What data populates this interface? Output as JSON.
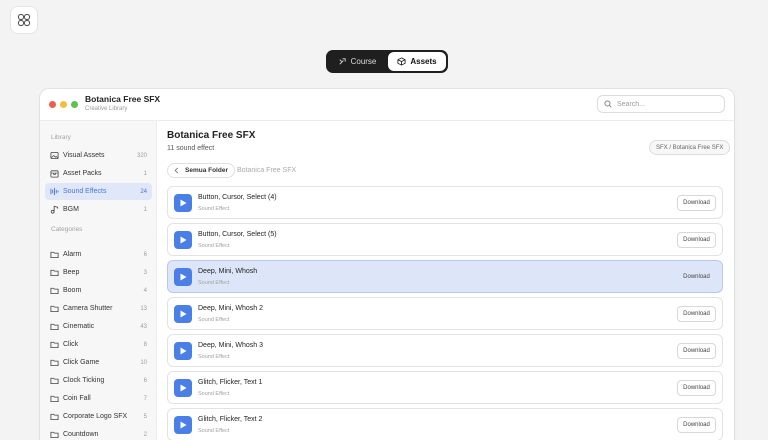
{
  "toggle": {
    "items": [
      {
        "label": "Course",
        "icon": "course-icon",
        "active": false
      },
      {
        "label": "Assets",
        "icon": "assets-icon",
        "active": true
      }
    ]
  },
  "window": {
    "title": "Botanica Free SFX",
    "subtitle": "Creative Library",
    "traffic_colors": [
      "#ee5d50",
      "#f5bd3a",
      "#5bc250"
    ]
  },
  "search": {
    "placeholder": "Search..."
  },
  "sidebar": {
    "library_heading": "Library",
    "library": [
      {
        "label": "Visual Assets",
        "count": "320",
        "icon": "image-icon"
      },
      {
        "label": "Asset Packs",
        "count": "1",
        "icon": "package-icon"
      },
      {
        "label": "Sound Effects",
        "count": "24",
        "icon": "music-icon",
        "active": true
      },
      {
        "label": "BGM",
        "count": "1",
        "icon": "music-note-icon"
      }
    ],
    "categories_heading": "Categories",
    "categories": [
      {
        "label": "Alarm",
        "count": "6"
      },
      {
        "label": "Beep",
        "count": "3"
      },
      {
        "label": "Boom",
        "count": "4"
      },
      {
        "label": "Camera Shutter",
        "count": "13"
      },
      {
        "label": "Cinematic",
        "count": "43"
      },
      {
        "label": "Click",
        "count": "8"
      },
      {
        "label": "Click Game",
        "count": "10"
      },
      {
        "label": "Clock Ticking",
        "count": "6"
      },
      {
        "label": "Coin Fall",
        "count": "7"
      },
      {
        "label": "Corporate Logo SFX",
        "count": "5"
      },
      {
        "label": "Countdown",
        "count": "2"
      }
    ]
  },
  "main": {
    "title": "Botanica Free SFX",
    "subtitle": "11 sound effect",
    "breadcrumb": "SFX / Botanica Free SFX",
    "back_label": "Semua Folder",
    "current_folder": "Botanica Free SFX",
    "download_label": "Download",
    "accent": "#4b7fe8",
    "items": [
      {
        "name": "Button, Cursor, Select (4)",
        "type": "Sound Effect"
      },
      {
        "name": "Button, Cursor, Select (5)",
        "type": "Sound Effect"
      },
      {
        "name": "Deep, Mini, Whosh",
        "type": "Sound Effect",
        "active": true
      },
      {
        "name": "Deep, Mini, Whosh 2",
        "type": "Sound Effect"
      },
      {
        "name": "Deep, Mini, Whosh 3",
        "type": "Sound Effect"
      },
      {
        "name": "Glitch, Flicker, Text 1",
        "type": "Sound Effect"
      },
      {
        "name": "Glitch, Flicker, Text 2",
        "type": "Sound Effect"
      }
    ]
  }
}
